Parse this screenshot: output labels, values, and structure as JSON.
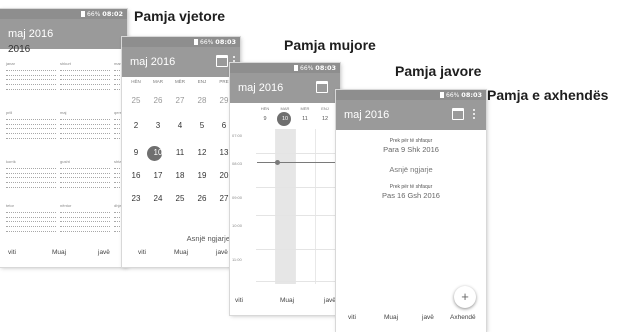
{
  "captions": {
    "year": "Pamja vjetore",
    "month": "Pamja mujore",
    "week": "Pamja javore",
    "agenda": "Pamja e axhendës"
  },
  "status": {
    "year": {
      "battery": "66%",
      "time": "08:02"
    },
    "month": {
      "battery": "66%",
      "time": "08:03"
    },
    "week": {
      "battery": "66%",
      "time": "08:03"
    },
    "agenda": {
      "battery": "66%",
      "time": "08:03"
    }
  },
  "app_title": "maj 2016",
  "year_view": {
    "year": "2016",
    "months": [
      "janar",
      "shkurt",
      "mars",
      "prill",
      "maj",
      "qershor",
      "korrik",
      "gusht",
      "shtator",
      "tetor",
      "nëntor",
      "dhjetor"
    ],
    "visible_months": [
      "janar",
      "shkurt",
      "mars",
      "prill",
      "maj",
      "qersh",
      "korrik",
      "gusht",
      "shtato",
      "tetor",
      "nëntor",
      "dhjetc"
    ]
  },
  "month_view": {
    "weekdays": [
      "HËN",
      "MAR",
      "MËR",
      "ENJ",
      "PRE"
    ],
    "rows": [
      [
        "25",
        "26",
        "27",
        "28",
        "29"
      ],
      [
        "2",
        "3",
        "4",
        "5",
        "6"
      ],
      [
        "9",
        "10",
        "11",
        "12",
        "13"
      ],
      [
        "16",
        "17",
        "18",
        "19",
        "20"
      ],
      [
        "23",
        "24",
        "25",
        "26",
        "27"
      ]
    ],
    "today": "10",
    "no_events": "Asnjë ngjarje"
  },
  "week_view": {
    "weekdays": [
      "HËN",
      "MAR",
      "MËR",
      "ENJ"
    ],
    "dates": [
      "9",
      "10",
      "11",
      "12"
    ],
    "today": "10",
    "hours": [
      "07:00",
      "08:03",
      "09:00",
      "10:00",
      "11:00"
    ]
  },
  "agenda_view": {
    "tap_hint_top": "Prek për të shfaqur",
    "date_top": "Para 9 Shk 2016",
    "no_events": "Asnjë ngjarje",
    "tap_hint_bottom": "Prek për të shfaqur",
    "date_bottom": "Pas 16 Gsh 2016",
    "fab": "+"
  },
  "nav": {
    "year_label": "viti",
    "month_label": "Muaj",
    "week_label": "javë",
    "agenda_label": "Axhendë"
  },
  "colors": {
    "appbar": "#9a9a9a",
    "statusbar": "#8e8e8e",
    "today_circle": "#6f6f6f"
  }
}
